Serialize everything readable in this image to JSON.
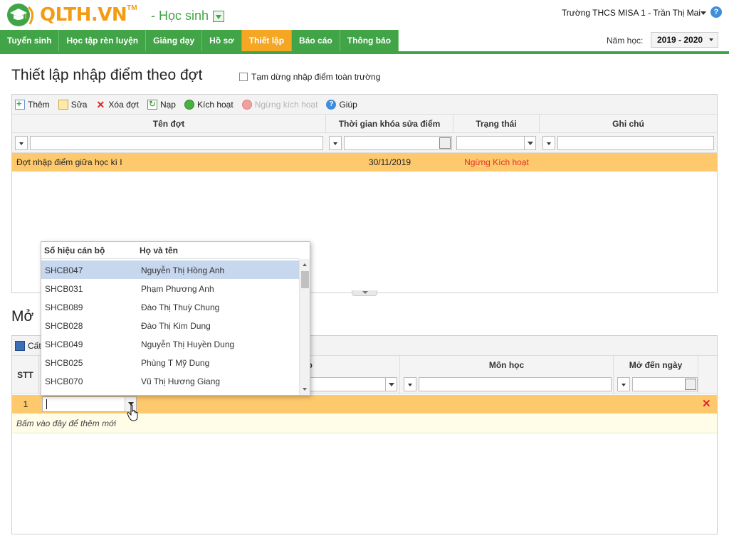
{
  "header": {
    "logo_text": "QLTH.VN",
    "logo_tm": "TM",
    "role": "- Học sinh",
    "user": "Trường THCS MISA 1 - Trần Thị Mai"
  },
  "nav": {
    "items": [
      {
        "label": "Tuyển sinh"
      },
      {
        "label": "Học tập rèn luyện"
      },
      {
        "label": "Giảng dạy"
      },
      {
        "label": "Hồ sơ"
      },
      {
        "label": "Thiết lập",
        "active": true
      },
      {
        "label": "Báo cáo"
      },
      {
        "label": "Thông báo"
      }
    ],
    "year_label": "Năm học:",
    "year_value": "2019 - 2020"
  },
  "section1": {
    "title": "Thiết lập nhập điểm theo đợt",
    "pause_label": "Tạm dừng nhập điểm toàn trường",
    "toolbar": {
      "add": "Thêm",
      "edit": "Sửa",
      "delete": "Xóa đợt",
      "reload": "Nạp",
      "activate": "Kích hoạt",
      "deactivate": "Ngừng kích hoạt",
      "help": "Giúp"
    },
    "columns": [
      "Tên đợt",
      "Thời gian khóa sửa điểm",
      "Trạng thái",
      "Ghi chú"
    ],
    "rows": [
      {
        "name": "Đợt nhập điểm giữa học kì I",
        "lock_date": "30/11/2019",
        "status": "Ngừng Kích hoạt",
        "note": ""
      }
    ]
  },
  "section2": {
    "title_partial": "Mở",
    "toolbar_partial": "Cất",
    "columns": {
      "stt": "STT",
      "class_partial": "ớp",
      "subject": "Môn học",
      "open_until": "Mở đến ngày"
    },
    "row": {
      "stt": "1"
    },
    "add_hint": "Bấm vào đây để thêm mới"
  },
  "dropdown": {
    "col_code": "Số hiệu cán bộ",
    "col_name": "Họ và tên",
    "items": [
      {
        "code": "SHCB047",
        "name": "Nguyễn Thị Hồng Anh"
      },
      {
        "code": "SHCB031",
        "name": "Phạm Phương Anh"
      },
      {
        "code": "SHCB089",
        "name": "Đào Thị Thuỳ Chung"
      },
      {
        "code": "SHCB028",
        "name": "Đào Thị Kim Dung"
      },
      {
        "code": "SHCB049",
        "name": "Nguyễn Thị Huyền Dung"
      },
      {
        "code": "SHCB025",
        "name": "Phùng T Mỹ Dung"
      },
      {
        "code": "SHCB070",
        "name": "Vũ Thị Hương Giang"
      }
    ]
  },
  "colors": {
    "brand_green": "#41a447",
    "brand_orange": "#f39c12",
    "active_tab": "#f5a623",
    "selected_row": "#fdc96c",
    "status_red": "#e0302a",
    "dropdown_highlight": "#c6d7ee"
  }
}
